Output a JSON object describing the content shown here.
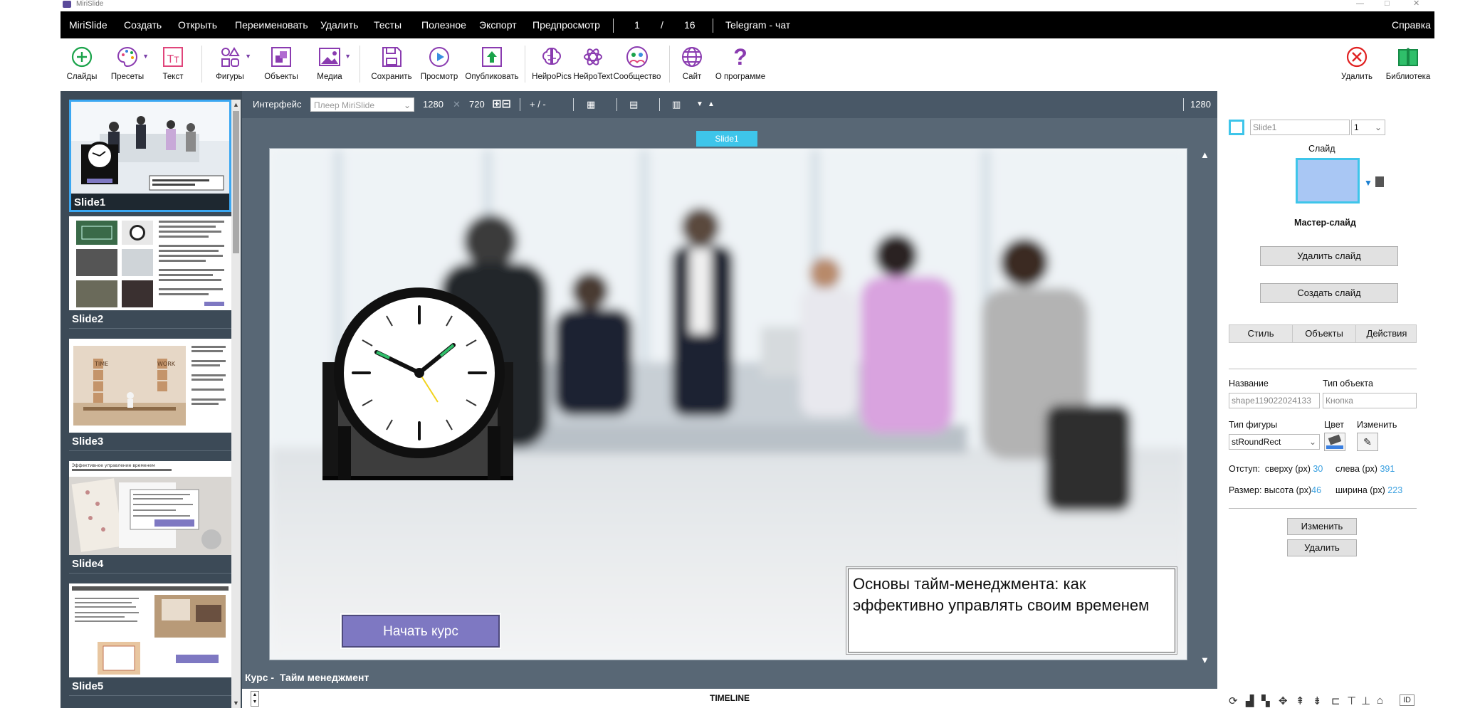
{
  "window": {
    "title": "MiriSlide",
    "minimize": "—",
    "maximize": "□",
    "close": "✕"
  },
  "menu": {
    "items": [
      "MiriSlide",
      "Создать",
      "Открыть",
      "Переименовать",
      "Удалить",
      "Тесты",
      "Полезное",
      "Экспорт",
      "Предпросмотр"
    ],
    "page_current": "1",
    "page_sep": "/",
    "page_total": "16",
    "telegram": "Telegram - чат",
    "help": "Справка"
  },
  "toolbar": {
    "slides": "Слайды",
    "presets": "Пресеты",
    "text": "Текст",
    "shapes": "Фигуры",
    "objects": "Объекты",
    "media": "Медиа",
    "save": "Сохранить",
    "preview": "Просмотр",
    "publish": "Опубликовать",
    "neuropics": "НейроPics",
    "neurotext": "НейроText",
    "community": "Сообщество",
    "site": "Сайт",
    "about": "О программе",
    "delete": "Удалить",
    "library": "Библиотека",
    "text_glyph": "Тт",
    "about_glyph": "?"
  },
  "slides": [
    {
      "name": "Slide1",
      "active": true
    },
    {
      "name": "Slide2",
      "active": false
    },
    {
      "name": "Slide3",
      "active": false
    },
    {
      "name": "Slide4",
      "active": false
    },
    {
      "name": "Slide5",
      "active": false
    }
  ],
  "thumb_captions": {
    "slide3_blocks": "TIME",
    "slide3_work": "WORK",
    "slide4_title": "Эффективное управление временем"
  },
  "canvas_bar": {
    "interface_label": "Интерфейс",
    "player": "Плеер MiriSlide",
    "width": "1280",
    "times": "✕",
    "height": "720",
    "zoom": "+ / -",
    "right_width": "1280"
  },
  "slide": {
    "tab": "Slide1",
    "button": "Начать курс",
    "text_box": "Основы тайм-менеджмента: как эффективно управлять своим временем"
  },
  "course": {
    "label": "Курс -",
    "name": "Тайм менеджмент"
  },
  "timeline": {
    "label": "TIMELINE"
  },
  "props": {
    "slide_name": "Slide1",
    "slide_num": "1",
    "slide_label": "Слайд",
    "master": "Мастер-слайд",
    "delete_slide": "Удалить слайд",
    "create_slide": "Создать слайд",
    "tabs": [
      "Стиль",
      "Объекты",
      "Действия"
    ],
    "name_label": "Название",
    "type_label": "Тип объекта",
    "name_value": "shape119022024133",
    "type_value": "Кнопка",
    "shape_label": "Тип фигуры",
    "color_label": "Цвет",
    "edit_label": "Изменить",
    "shape_value": "stRoundRect",
    "offset_label": "Отступ:",
    "top_label": "сверху (px)",
    "top_value": "30",
    "left_label": "слева (px)",
    "left_value": "391",
    "size_label": "Размер:",
    "h_label": "высота (px)",
    "h_value": "46",
    "w_label": "ширина (px)",
    "w_value": "223",
    "apply": "Изменить",
    "remove": "Удалить",
    "id_badge": "ID"
  },
  "colors": {
    "menubar": "#000000",
    "panel": "#3c4a57",
    "canvas": "#586775",
    "accent": "#3ec5ea",
    "button": "#7e78c2",
    "toolbar_icon": "#8a3bb0"
  }
}
